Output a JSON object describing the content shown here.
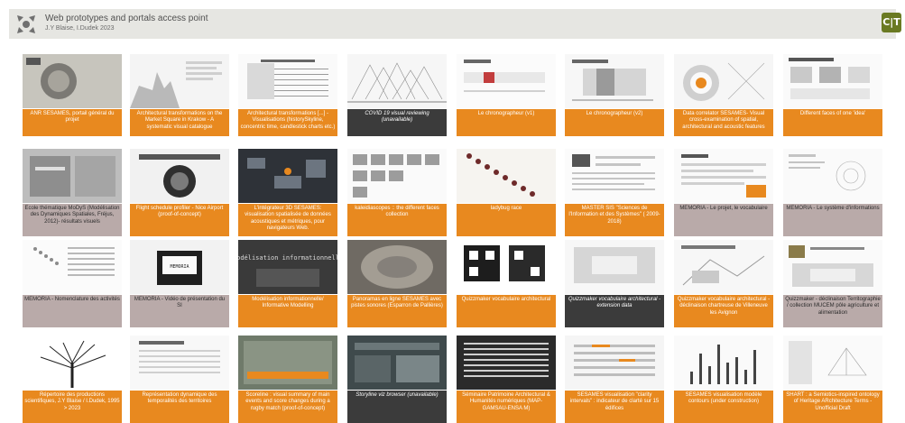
{
  "header": {
    "title": "Web prototypes and portals access point",
    "subtitle": "J.Y Blaise, I.Dudek 2023",
    "badge": "C|T"
  },
  "cards": [
    {
      "label": "ANR SESAMES, portail général du projet",
      "style": "orange"
    },
    {
      "label": "Architectural transformations on the Market Square in Krakow - A systematic visual catalogue",
      "style": "orange"
    },
    {
      "label": "Architectural transformations [...] - Visualisations (historySkyline, concentric time, candlestick charts etc.)",
      "style": "orange"
    },
    {
      "label": "COVID 19 visual reviewing (unavailable)",
      "style": "dark"
    },
    {
      "label": "Le chronographeur (v1)",
      "style": "orange"
    },
    {
      "label": "Le chronographeur (v2)",
      "style": "orange"
    },
    {
      "label": "Data correlator SESAMES- Visual cross-examination of spatial, architectural and acoustic features",
      "style": "orange"
    },
    {
      "label": "Different faces of one 'idea'",
      "style": "orange"
    },
    {
      "label": "Ecole thématique MoDyS (Modélisation des Dynamiques Spatiales, Fréjus, 2012)- résultats visuels",
      "style": "gray"
    },
    {
      "label": "Flight schedule profiler - Nice Airport (proof-of-concept)",
      "style": "orange"
    },
    {
      "label": "L'intégrateur 3D SESAMES: visualisation spatialisée de données acoustiques et métriques, pour navigateurs Web.",
      "style": "orange"
    },
    {
      "label": "kaleidiascopes :: the different faces collection",
      "style": "orange"
    },
    {
      "label": "ladybug race",
      "style": "orange"
    },
    {
      "label": "MASTER SIS \"Sciences de l'Information et des Systèmes\" ( 2009-2018)",
      "style": "orange"
    },
    {
      "label": "MEMORIA - Le projet, le vocabulaire",
      "style": "gray"
    },
    {
      "label": "MEMORIA - Le système d'informations",
      "style": "gray"
    },
    {
      "label": "MEMORIA - Nomenclature des activités",
      "style": "gray"
    },
    {
      "label": "MEMORIA - Vidéo de présentation du SI",
      "style": "gray"
    },
    {
      "label": "Modélisation informationnelle/ Informative Modelling",
      "style": "orange"
    },
    {
      "label": "Panoramas en ligne SESAMES avec pistes sonores (Esparron de Pallières)",
      "style": "orange"
    },
    {
      "label": "Quizzmaker vocabulaire architectural",
      "style": "orange"
    },
    {
      "label": "Quizzmaker vocabulaire architectural - extension data",
      "style": "dark"
    },
    {
      "label": "Quizzmaker vocabulaire architectural - déclinaison chartreuse de Villeneuve les Avignon",
      "style": "orange"
    },
    {
      "label": "Quizzmaker - déclinaison Territographie / collection MUCEM pôle agriculture et alimentation",
      "style": "gray"
    },
    {
      "label": "Répertoire des productions scientifiques, J.Y Blaise / I.Dudek, 1995 > 2023",
      "style": "orange"
    },
    {
      "label": "Représentation dynamique des temporalités des territoires",
      "style": "orange"
    },
    {
      "label": "Scoreline : visual summary of main events and score changes during a rugby match (proof-of-concept)",
      "style": "orange"
    },
    {
      "label": "Storyline viz browser (unavailable)",
      "style": "dark"
    },
    {
      "label": "Séminaire Patrimoine Architectural & Humanités numériques (MAP-GAMSAU-ENSA M)",
      "style": "orange"
    },
    {
      "label": "SESAMES visualisation \"clarity intervals\" : indicateur de clarté sur 15 édifices",
      "style": "orange"
    },
    {
      "label": "SESAMES visualisation modèle contours (under construction)",
      "style": "orange"
    },
    {
      "label": "SHART : a Semiotics-inspired ontology of Heritage ARchitecture Terms - Unofficial Draft",
      "style": "orange"
    }
  ],
  "thumb_texts": {
    "modelling": "modélisation informationnelle",
    "memoria": "MEMORIA"
  }
}
